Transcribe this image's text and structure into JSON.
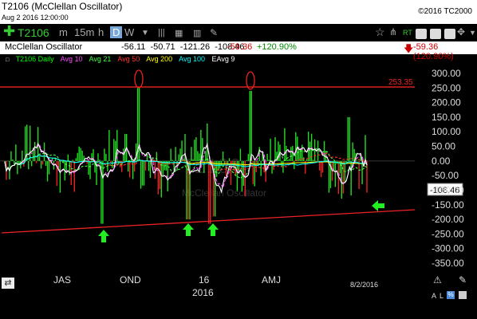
{
  "window": {
    "title": "T2106 (McClellan Oscillator)",
    "date": "Aug 2 2016 12:00:00",
    "copyright": "©2016 TC2000"
  },
  "toolbar": {
    "symbol": "T2106",
    "timeframes": [
      "m",
      "15m",
      "h",
      "D",
      "W"
    ],
    "active_timeframe": "D",
    "rt_label": "RT"
  },
  "info": {
    "name": "McClellan Oscillator",
    "values": "-56.11  -50.71  -121.26  -108.46",
    "change": "-59.36",
    "pct": "+120.90%",
    "right_change": "-59.36 (120.90%)"
  },
  "legend": [
    {
      "label": "T2106 Daily",
      "color": "#00ff00"
    },
    {
      "label": "Avg 10",
      "color": "#ff44ff"
    },
    {
      "label": "Avg 21",
      "color": "#44ff44"
    },
    {
      "label": "Avg 50",
      "color": "#ff3333"
    },
    {
      "label": "Avg 200",
      "color": "#ffff00"
    },
    {
      "label": "Avg 100",
      "color": "#00ffff"
    },
    {
      "label": "EAvg 9",
      "color": "#ffffff"
    }
  ],
  "chart_data": {
    "type": "bar",
    "title": "McClellan Oscillator",
    "ylim": [
      -350,
      300
    ],
    "yticks": [
      "300.00",
      "250.00",
      "200.00",
      "150.00",
      "100.00",
      "50.00",
      "0.00",
      "-50.00",
      "-100.00",
      "-150.00",
      "-200.00",
      "-250.00",
      "-300.00",
      "-350.00"
    ],
    "resistance_label": "253.35",
    "resistance_value": 253.35,
    "last_value_label": "-108.46",
    "last_value": -108.46,
    "x_tick_labels": [
      "JAS",
      "OND",
      "16",
      "AMJ"
    ],
    "year_label": "2016",
    "end_date": "8/2/2016"
  }
}
